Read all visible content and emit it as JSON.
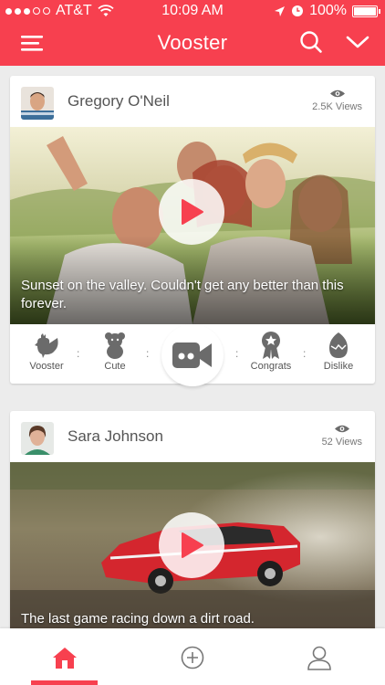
{
  "status_bar": {
    "carrier": "AT&T",
    "time": "10:09 AM",
    "battery": "100%"
  },
  "header": {
    "title": "Vooster"
  },
  "feed": [
    {
      "user": "Gregory O'Neil",
      "views": "2.5K Views",
      "caption": "Sunset on the valley. Couldn't get any better than this forever."
    },
    {
      "user": "Sara Johnson",
      "views": "52 Views",
      "caption": "The last game racing down a dirt road."
    }
  ],
  "reactions": [
    {
      "label": "Vooster",
      "icon": "rooster-icon"
    },
    {
      "label": "Cute",
      "icon": "teddy-bear-icon"
    },
    {
      "label": "Congrats",
      "icon": "award-ribbon-icon"
    },
    {
      "label": "Dislike",
      "icon": "egg-icon"
    }
  ],
  "tabs": [
    {
      "name": "home",
      "icon": "home-icon",
      "active": true
    },
    {
      "name": "add",
      "icon": "add-circle-icon",
      "active": false
    },
    {
      "name": "profile",
      "icon": "profile-icon",
      "active": false
    }
  ],
  "colors": {
    "accent": "#f7404f",
    "icon_gray": "#6b6b6b",
    "background": "#ececec"
  }
}
